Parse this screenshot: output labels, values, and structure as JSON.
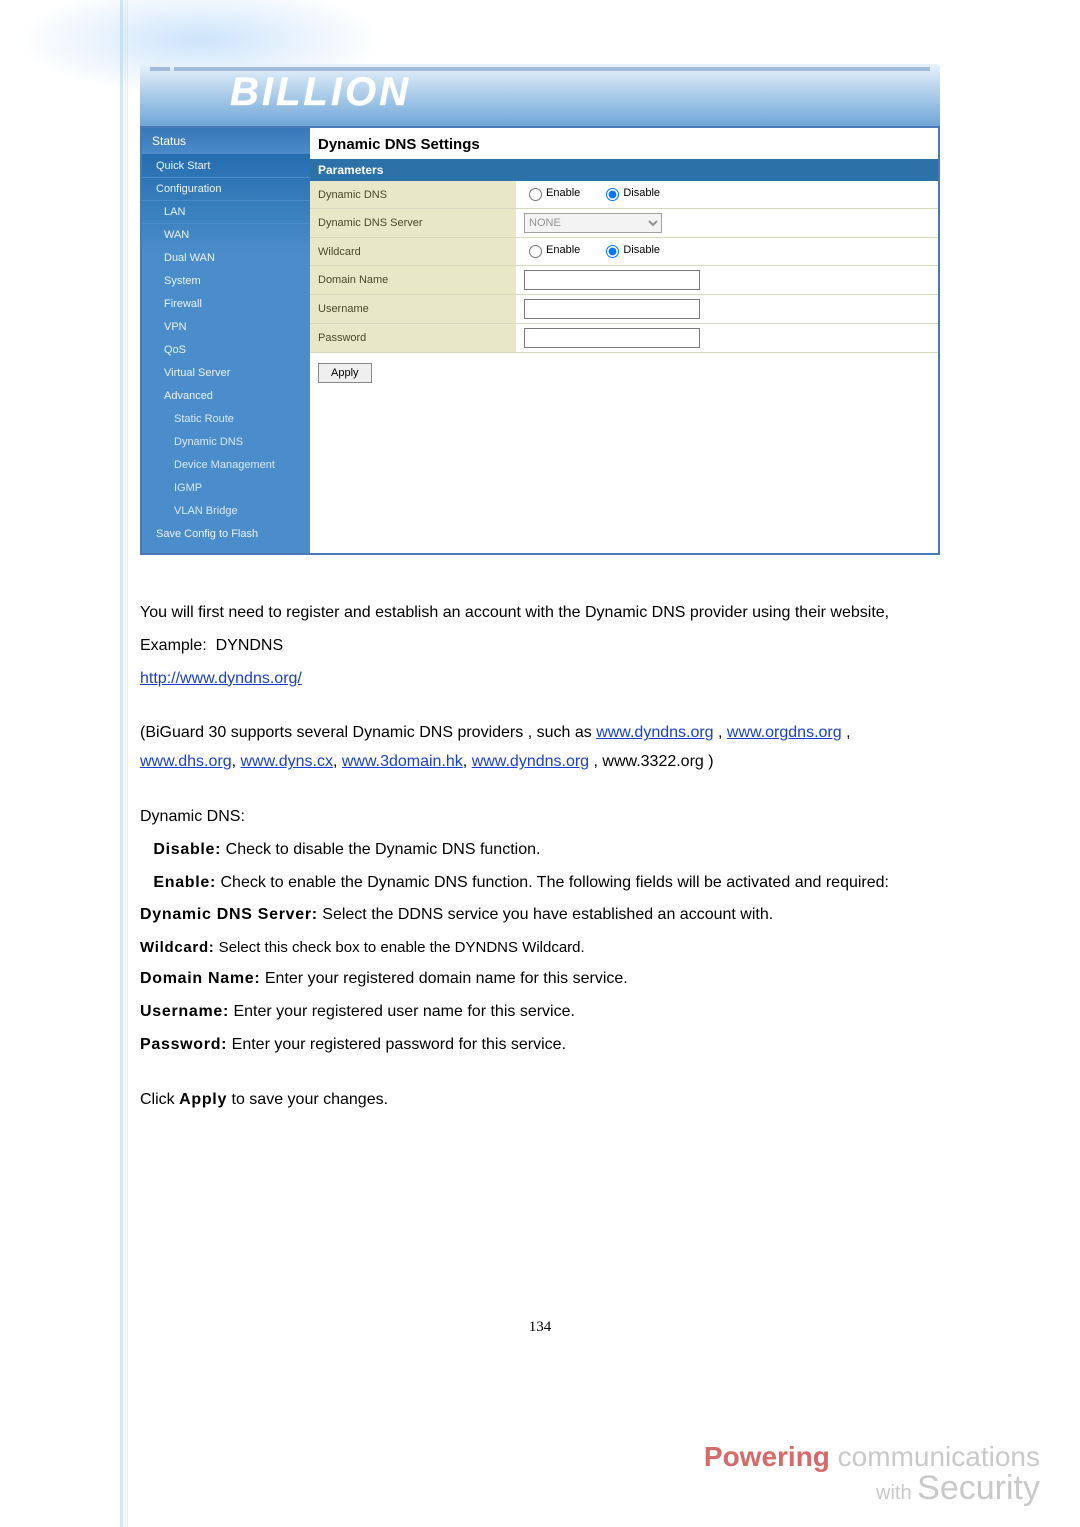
{
  "logo_text": "BILLION",
  "router": {
    "sidebar": {
      "header": "Status",
      "items": [
        {
          "label": "Quick Start",
          "lvl": 0
        },
        {
          "label": "Configuration",
          "lvl": 0
        },
        {
          "label": "LAN",
          "lvl": 1
        },
        {
          "label": "WAN",
          "lvl": 1
        },
        {
          "label": "Dual WAN",
          "lvl": 1
        },
        {
          "label": "System",
          "lvl": 1
        },
        {
          "label": "Firewall",
          "lvl": 1
        },
        {
          "label": "VPN",
          "lvl": 1
        },
        {
          "label": "QoS",
          "lvl": 1
        },
        {
          "label": "Virtual Server",
          "lvl": 1
        },
        {
          "label": "Advanced",
          "lvl": 1
        },
        {
          "label": "Static Route",
          "lvl": 2
        },
        {
          "label": "Dynamic DNS",
          "lvl": 2
        },
        {
          "label": "Device Management",
          "lvl": 2
        },
        {
          "label": "IGMP",
          "lvl": 2
        },
        {
          "label": "VLAN Bridge",
          "lvl": 2
        },
        {
          "label": "Save Config to Flash",
          "lvl": 0
        }
      ]
    },
    "title": "Dynamic DNS Settings",
    "section": "Parameters",
    "rows": {
      "dyn_dns_label": "Dynamic DNS",
      "server_label": "Dynamic DNS Server",
      "server_value": "NONE",
      "wildcard_label": "Wildcard",
      "domain_label": "Domain Name",
      "username_label": "Username",
      "password_label": "Password",
      "enable_label": "Enable",
      "disable_label": "Disable",
      "domain_value": "",
      "username_value": "",
      "password_value": ""
    },
    "apply_label": "Apply",
    "dyn_dns_selected": "disable",
    "wildcard_selected": "disable"
  },
  "doc": {
    "intro1": "You will first need to register and establish an account with the Dynamic DNS provider using their website,",
    "example_label": "Example:",
    "example_value": "DYNDNS",
    "example_link": "http://www.dyndns.org/",
    "supports_a": "(BiGuard 30 supports several Dynamic DNS providers , such as ",
    "links": {
      "dyndns": "www.dyndns.org",
      "orgdns": "www.orgdns.org",
      "dhs": "www.dhs.org",
      "dyns": "www.dyns.cx",
      "threedomain": "www.3domain.hk",
      "dyndns2": "www.dyndns.org"
    },
    "supports_tail": " , www.3322.org )",
    "ddns_title": "Dynamic DNS:",
    "disable_b": "Disable:",
    "disable_t": " Check to disable the Dynamic DNS function.",
    "enable_b": "Enable:",
    "enable_t": " Check to enable the Dynamic DNS function. The following fields will be activated and required:",
    "server_b": "Dynamic DNS Server:",
    "server_t": " Select the DDNS service you have established an account with.",
    "wild_b": "Wildcard:",
    "wild_t": " Select this check box to enable the DYNDNS Wildcard.",
    "dom_b": "Domain Name:",
    "dom_t": " Enter your registered domain name for this service.",
    "usr_b": "Username:",
    "usr_t": " Enter your registered user name for this service.",
    "pwd_b": "Password:",
    "pwd_t": " Enter your registered password for this service.",
    "apply_sent_a": "Click ",
    "apply_sent_b": "Apply",
    "apply_sent_c": " to save your changes.",
    "page_num": "134"
  },
  "footer": {
    "l1_bold": "Powering",
    "l1_rest": " communications",
    "l2_small": "with ",
    "l2_big": "Security"
  }
}
